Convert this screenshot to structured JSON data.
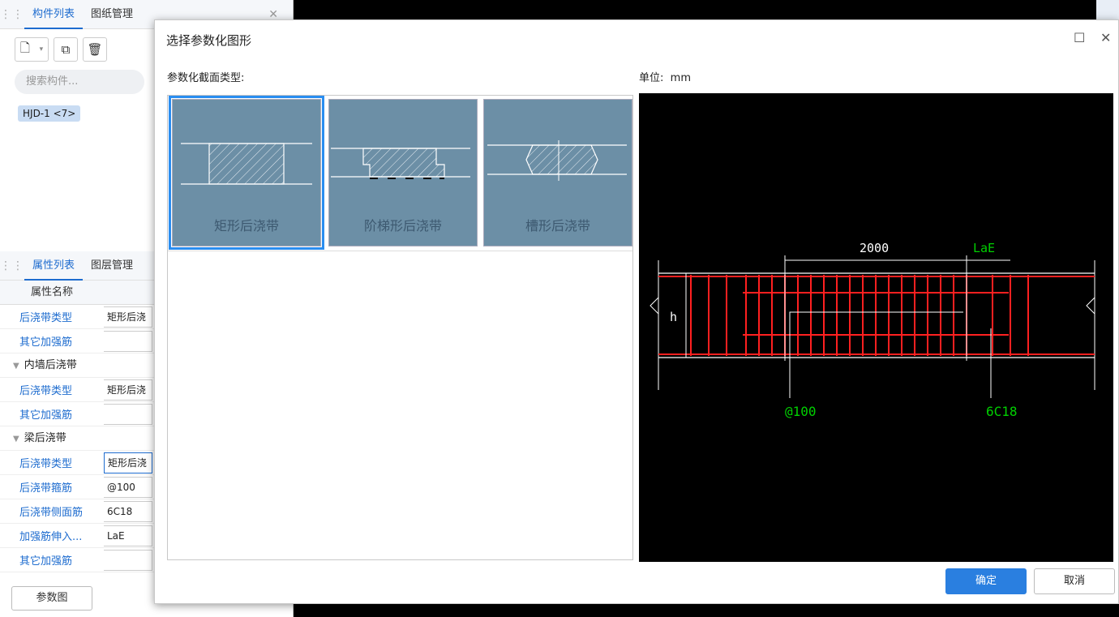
{
  "left_panel": {
    "top_tabs": [
      "构件列表",
      "图纸管理"
    ],
    "search_placeholder": "搜索构件...",
    "component": "HJD-1 <7>",
    "bottom_tabs": [
      "属性列表",
      "图层管理"
    ],
    "prop_header": "属性名称",
    "rows_top": [
      {
        "name": "后浇带类型",
        "value": "矩形后浇"
      },
      {
        "name": "其它加强筋",
        "value": ""
      }
    ],
    "group1": "内墙后浇带",
    "rows_g1": [
      {
        "name": "后浇带类型",
        "value": "矩形后浇"
      },
      {
        "name": "其它加强筋",
        "value": ""
      }
    ],
    "group2": "梁后浇带",
    "rows_g2": [
      {
        "name": "后浇带类型",
        "value": "矩形后浇"
      },
      {
        "name": "后浇带箍筋",
        "value": "@100"
      },
      {
        "name": "后浇带侧面筋",
        "value": "6C18"
      },
      {
        "name": "加强筋伸入...",
        "value": "LaE"
      },
      {
        "name": "其它加强筋",
        "value": ""
      }
    ],
    "param_button": "参数图"
  },
  "dialog": {
    "title": "选择参数化图形",
    "section_label": "参数化截面类型:",
    "unit_label": "单位:",
    "unit_value": "mm",
    "cards": [
      {
        "label": "矩形后浇带",
        "selected": true
      },
      {
        "label": "阶梯形后浇带",
        "selected": false
      },
      {
        "label": "槽形后浇带",
        "selected": false
      }
    ],
    "preview": {
      "dim_length": "2000",
      "dim_anchor": "LaE",
      "height_label": "h",
      "stirrup": "@100",
      "side_bar": "6C18"
    },
    "ok_label": "确定",
    "cancel_label": "取消"
  },
  "colors": {
    "accent": "#2a7fe0",
    "card_bg": "#6c8fa6",
    "rebar": "#ff2020",
    "annot": "#00d000"
  }
}
